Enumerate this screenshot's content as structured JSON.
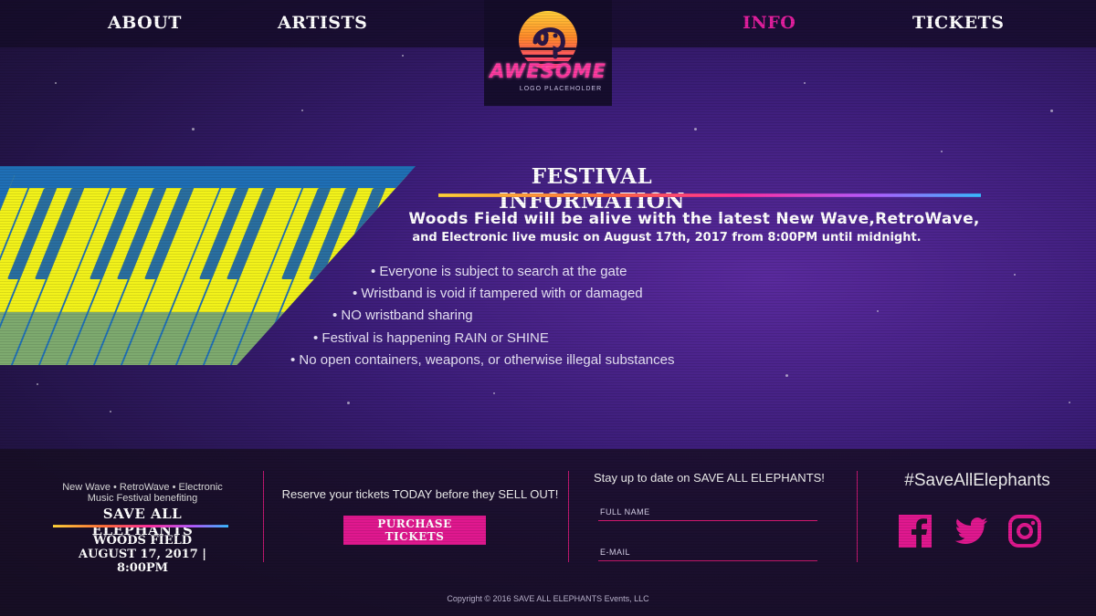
{
  "nav": {
    "about": "ABOUT",
    "artists": "ARTISTS",
    "info": "INFO",
    "tickets": "TICKETS",
    "active": "INFO"
  },
  "logo": {
    "word": "AWESOME",
    "sub": "LOGO PLACEHOLDER"
  },
  "info": {
    "title": "FESTIVAL INFORMATION",
    "intro_line1": "Woods Field will be alive with the latest New Wave,RetroWave,",
    "intro_line2": "and Electronic live music on August 17th, 2017 from 8:00PM until midnight.",
    "rules": [
      "• Everyone is subject to search at the gate",
      "• Wristband is void if tampered with or damaged",
      "• NO wristband sharing",
      "• Festival is happening RAIN or SHINE",
      "• No open containers, weapons, or otherwise illegal substances"
    ]
  },
  "footer": {
    "tagline1": "New Wave • RetroWave • Electronic",
    "tagline2": "Music Festival benefiting",
    "org": "SAVE ALL ELEPHANTS",
    "venue": "WOODS FIELD",
    "date": "AUGUST 17, 2017 | 8:00PM",
    "reserve_text": "Reserve your tickets TODAY before they SELL OUT!",
    "purchase_label": "PURCHASE TICKETS",
    "stay_text": "Stay up to date on SAVE ALL ELEPHANTS!",
    "full_name_placeholder": "FULL NAME",
    "email_placeholder": "E-MAIL",
    "hashtag": "#SaveAllElephants",
    "copyright": "Copyright © 2016 SAVE ALL ELEPHANTS Events, LLC"
  },
  "colors": {
    "accent": "#e0188f",
    "active_nav": "#e11f9e",
    "background": "#3b1d78",
    "keyboard_keys": "#f2f21a",
    "keyboard_body": "#1f6fb6"
  },
  "icons": [
    "facebook-icon",
    "twitter-icon",
    "instagram-icon",
    "elephant-logo-icon"
  ]
}
